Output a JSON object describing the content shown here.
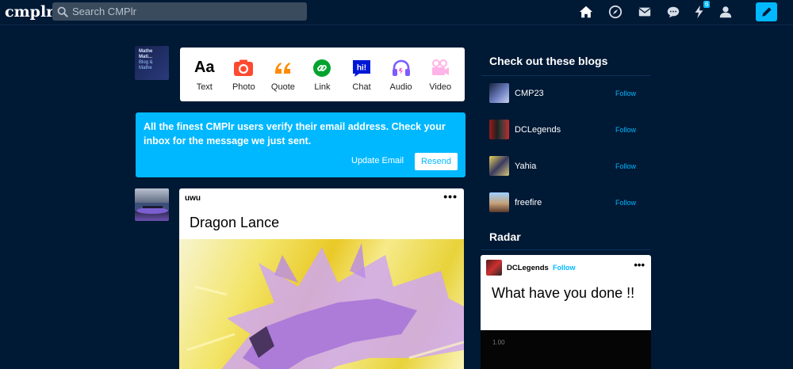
{
  "header": {
    "logo": "cmplr",
    "search_placeholder": "Search CMPlr",
    "icons": [
      "home-icon",
      "explore-icon",
      "mail-icon",
      "chat-icon",
      "activity-icon",
      "account-icon",
      "compose-icon"
    ],
    "activity_badge": "6",
    "accent": "#00b8ff"
  },
  "self_avatar": {
    "line1": "Mathe",
    "line2": "Mati...",
    "line3": "Blog & Mathe"
  },
  "post_types": [
    {
      "label": "Text",
      "icon": "text-icon",
      "glyph": "Aa",
      "color": "#000000"
    },
    {
      "label": "Photo",
      "icon": "camera-icon",
      "color": "#ff4930"
    },
    {
      "label": "Quote",
      "icon": "quote-icon",
      "color": "#ff8a00"
    },
    {
      "label": "Link",
      "icon": "link-icon",
      "color": "#00a32e"
    },
    {
      "label": "Chat",
      "icon": "chat-bubble-icon",
      "glyph": "hi!",
      "color": "#0018d6"
    },
    {
      "label": "Audio",
      "icon": "headphones-icon",
      "color": "#7c5cff"
    },
    {
      "label": "Video",
      "icon": "video-camera-icon",
      "color": "#ff62ce"
    }
  ],
  "verify_banner": {
    "message": "All the finest CMPlr users verify their email address. Check your inbox for the message we just sent.",
    "update_label": "Update Email",
    "resend_label": "Resend"
  },
  "post": {
    "author": "uwu",
    "title": "Dragon Lance"
  },
  "sidebar": {
    "blogs_heading": "Check out these blogs",
    "blogs": [
      {
        "name": "CMP23",
        "follow": "Follow"
      },
      {
        "name": "DCLegends",
        "follow": "Follow"
      },
      {
        "name": "Yahia",
        "follow": "Follow"
      },
      {
        "name": "freefire",
        "follow": "Follow"
      }
    ],
    "radar_heading": "Radar",
    "radar": {
      "author": "DCLegends",
      "follow": "Follow",
      "title": "What have you done !!",
      "media_label": "1.00"
    }
  }
}
